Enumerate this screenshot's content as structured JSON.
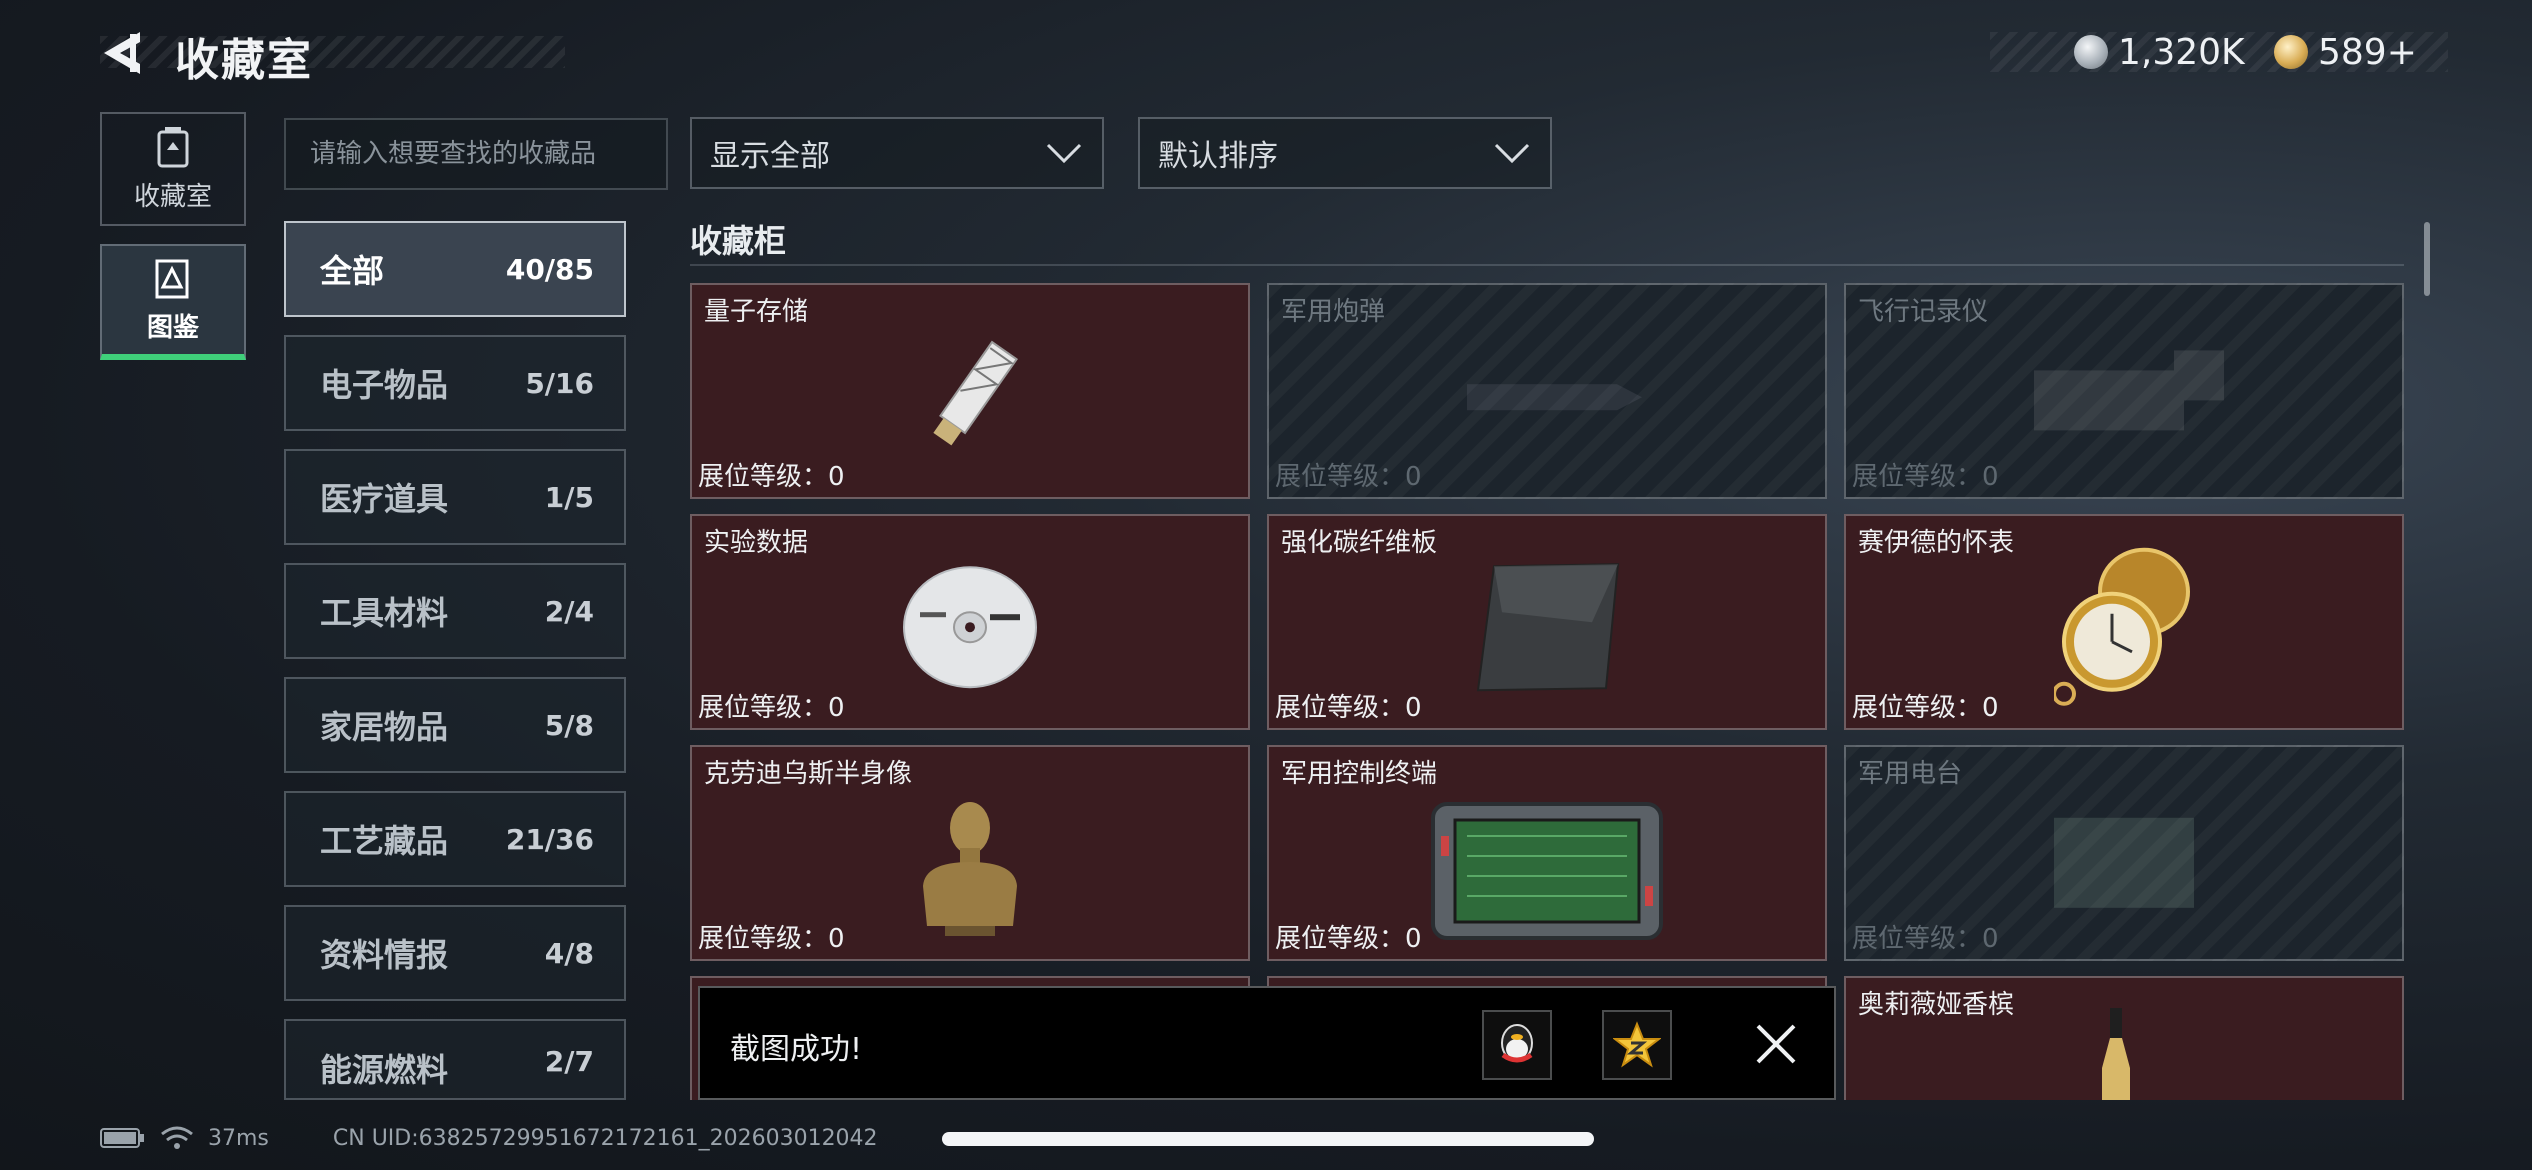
{
  "header": {
    "title": "收藏室",
    "currency": [
      {
        "icon": "silver-coin-icon",
        "value": "1,320K"
      },
      {
        "icon": "gold-coin-icon",
        "value": "589+"
      }
    ]
  },
  "nav": [
    {
      "label": "收藏室",
      "icon": "trash-bin-icon"
    },
    {
      "label": "图鉴",
      "icon": "gallery-icon",
      "active": true
    }
  ],
  "search": {
    "placeholder": "请输入想要查找的收藏品"
  },
  "filters": {
    "display": "显示全部",
    "sort": "默认排序"
  },
  "categories": [
    {
      "name": "全部",
      "count": "40/85",
      "active": true
    },
    {
      "name": "电子物品",
      "count": "5/16"
    },
    {
      "name": "医疗道具",
      "count": "1/5"
    },
    {
      "name": "工具材料",
      "count": "2/4"
    },
    {
      "name": "家居物品",
      "count": "5/8"
    },
    {
      "name": "工艺藏品",
      "count": "21/36"
    },
    {
      "name": "资料情报",
      "count": "4/8"
    },
    {
      "name": "能源燃料",
      "count": "2/7"
    }
  ],
  "grid": {
    "section_title": "收藏柜",
    "items": [
      {
        "name": "量子存储",
        "level": "展位等级：0",
        "unlocked": true,
        "icon": "usb-drive-icon"
      },
      {
        "name": "军用炮弹",
        "level": "展位等级：0",
        "unlocked": false,
        "icon": "shell-icon"
      },
      {
        "name": "飞行记录仪",
        "level": "展位等级：0",
        "unlocked": false,
        "icon": "flight-recorder-icon"
      },
      {
        "name": "实验数据",
        "level": "展位等级：0",
        "unlocked": true,
        "icon": "disc-icon"
      },
      {
        "name": "强化碳纤维板",
        "level": "展位等级：0",
        "unlocked": true,
        "icon": "carbon-plate-icon"
      },
      {
        "name": "赛伊德的怀表",
        "level": "展位等级：0",
        "unlocked": true,
        "icon": "pocket-watch-icon"
      },
      {
        "name": "克劳迪乌斯半身像",
        "level": "展位等级：0",
        "unlocked": true,
        "icon": "bust-icon"
      },
      {
        "name": "军用控制终端",
        "level": "展位等级：0",
        "unlocked": true,
        "icon": "terminal-icon"
      },
      {
        "name": "军用电台",
        "level": "展位等级：0",
        "unlocked": false,
        "icon": "radio-icon"
      },
      {
        "name": "",
        "level": "",
        "unlocked": true,
        "icon": ""
      },
      {
        "name": "",
        "level": "",
        "unlocked": true,
        "icon": ""
      },
      {
        "name": "奥莉薇娅香槟",
        "level": "",
        "unlocked": true,
        "icon": "champagne-icon"
      }
    ]
  },
  "toast": {
    "text": "截图成功!",
    "share": [
      "qq-share-icon",
      "qzone-share-icon"
    ],
    "close_icon": "close-icon"
  },
  "status": {
    "ping": "37ms",
    "uid": "CN UID:6382572995167217216​1_202603012042"
  }
}
